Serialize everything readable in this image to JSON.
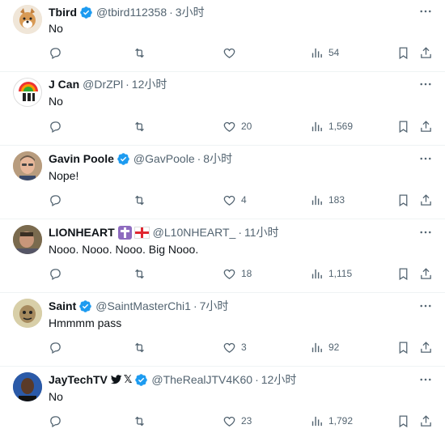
{
  "colors": {
    "verified": "#1d9bf0",
    "muted": "#536471",
    "text": "#0f1419",
    "divider": "#eff3f4"
  },
  "tweets": [
    {
      "name": "Tbird",
      "handle": "@tbird112358",
      "dot": "·",
      "time": "3小时",
      "text": "No",
      "replies": "",
      "retweets": "",
      "likes": "",
      "views": "54",
      "verified": true,
      "avatar": "dog-avatar"
    },
    {
      "name": "J Can",
      "handle": "@DrZPl",
      "dot": "·",
      "time": "12小时",
      "text": "No",
      "replies": "",
      "retweets": "",
      "likes": "20",
      "views": "1,569",
      "verified": false,
      "avatar": "rainbow-umbrella-avatar"
    },
    {
      "name": "Gavin Poole",
      "handle": "@GavPoole",
      "dot": "·",
      "time": "8小时",
      "text": "Nope!",
      "replies": "",
      "retweets": "",
      "likes": "4",
      "views": "183",
      "verified": true,
      "avatar": "man-avatar"
    },
    {
      "name": "LIONHEART",
      "handle": "@L10NHEART_",
      "dot": "·",
      "time": "11小时",
      "text": "Nooo. Nooo. Nooo. Big Nooo.",
      "replies": "",
      "retweets": "",
      "likes": "18",
      "views": "1,115",
      "verified": false,
      "avatar": "man-photo-avatar"
    },
    {
      "name": "Saint",
      "handle": "@SaintMasterChi1",
      "dot": "·",
      "time": "7小时",
      "text": "Hmmmm pass",
      "replies": "",
      "retweets": "",
      "likes": "3",
      "views": "92",
      "verified": true,
      "avatar": "cartoon-avatar"
    },
    {
      "name": "JayTechTV",
      "handle": "@TheRealJTV4K60",
      "dot": "·",
      "time": "12小时",
      "text": "No",
      "replies": "",
      "retweets": "",
      "likes": "23",
      "views": "1,792",
      "verified": true,
      "avatar": "person-avatar"
    }
  ],
  "badges": {
    "x_glyph": "𝕏"
  }
}
